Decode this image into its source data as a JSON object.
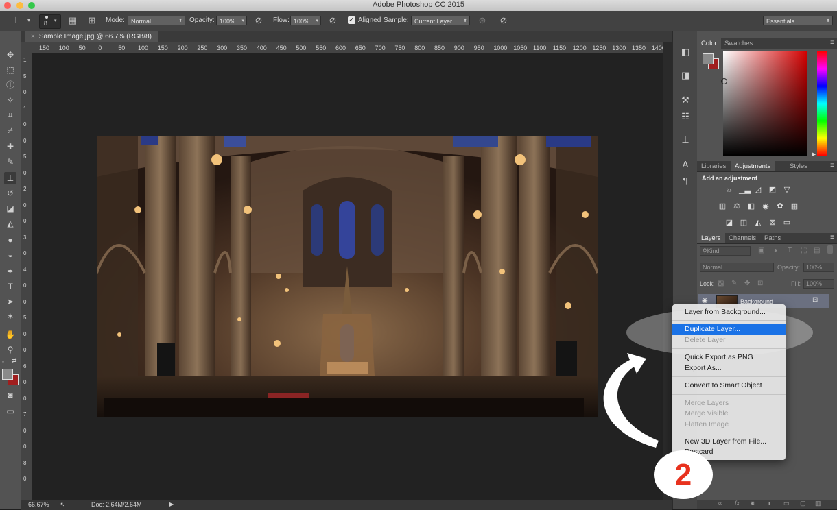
{
  "window": {
    "title": "Adobe Photoshop CC 2015"
  },
  "options_bar": {
    "brush_size": "8",
    "mode_label": "Mode:",
    "mode_value": "Normal",
    "opacity_label": "Opacity:",
    "opacity_value": "100%",
    "flow_label": "Flow:",
    "flow_value": "100%",
    "aligned_label": "Aligned",
    "sample_label": "Sample:",
    "sample_value": "Current Layer",
    "workspace_value": "Essentials"
  },
  "document": {
    "tab_title": "Sample Image.jpg @ 66.7% (RGB/8)",
    "ruler_h_labels": [
      "150",
      "100",
      "50",
      "0",
      "50",
      "100",
      "150",
      "200",
      "250",
      "300",
      "350",
      "400",
      "450",
      "500",
      "550",
      "600",
      "650",
      "700",
      "750",
      "800",
      "850",
      "900",
      "950",
      "1000",
      "1050",
      "1100",
      "1150",
      "1200",
      "1250",
      "1300",
      "1350",
      "1400"
    ],
    "ruler_v_labels": [
      "1",
      "5",
      "0",
      "1",
      "0",
      "0",
      "5",
      "0",
      "2",
      "0",
      "0",
      "3",
      "0",
      "4",
      "0",
      "0",
      "5",
      "0",
      "0",
      "6",
      "0",
      "0",
      "7",
      "0",
      "0",
      "8",
      "0"
    ],
    "zoom": "66.67%",
    "doc_size": "Doc: 2.64M/2.64M"
  },
  "panels": {
    "color_tabs": [
      "Color",
      "Swatches"
    ],
    "adjust_tabs": [
      "Libraries",
      "Adjustments",
      "Styles"
    ],
    "adjust_heading": "Add an adjustment",
    "layers_tabs": [
      "Layers",
      "Channels",
      "Paths"
    ],
    "layers_filter": "Kind",
    "blend_mode": "Normal",
    "opacity_label": "Opacity:",
    "opacity_value": "100%",
    "lock_label": "Lock:",
    "fill_label": "Fill:",
    "fill_value": "100%",
    "layer_name": "Background"
  },
  "context_menu": {
    "items": [
      {
        "label": "Layer from Background...",
        "disabled": false
      },
      {
        "label": "Duplicate Layer...",
        "disabled": false,
        "highlighted": true
      },
      {
        "label": "Delete Layer",
        "disabled": true
      },
      {
        "label": "Quick Export as PNG",
        "disabled": false
      },
      {
        "label": "Export As...",
        "disabled": false
      },
      {
        "label": "Convert to Smart Object",
        "disabled": false
      },
      {
        "label": "Merge Layers",
        "disabled": true
      },
      {
        "label": "Merge Visible",
        "disabled": true
      },
      {
        "label": "Flatten Image",
        "disabled": true
      },
      {
        "label": "New 3D Layer from File...",
        "disabled": false
      },
      {
        "label": "Postcard",
        "disabled": false
      }
    ]
  },
  "annotation": {
    "step_number": "2"
  },
  "colors": {
    "highlight": "#1a72e6",
    "step_number": "#e8321e",
    "background_swatch": "#a01e1e",
    "foreground_swatch": "#8a8a8a"
  }
}
